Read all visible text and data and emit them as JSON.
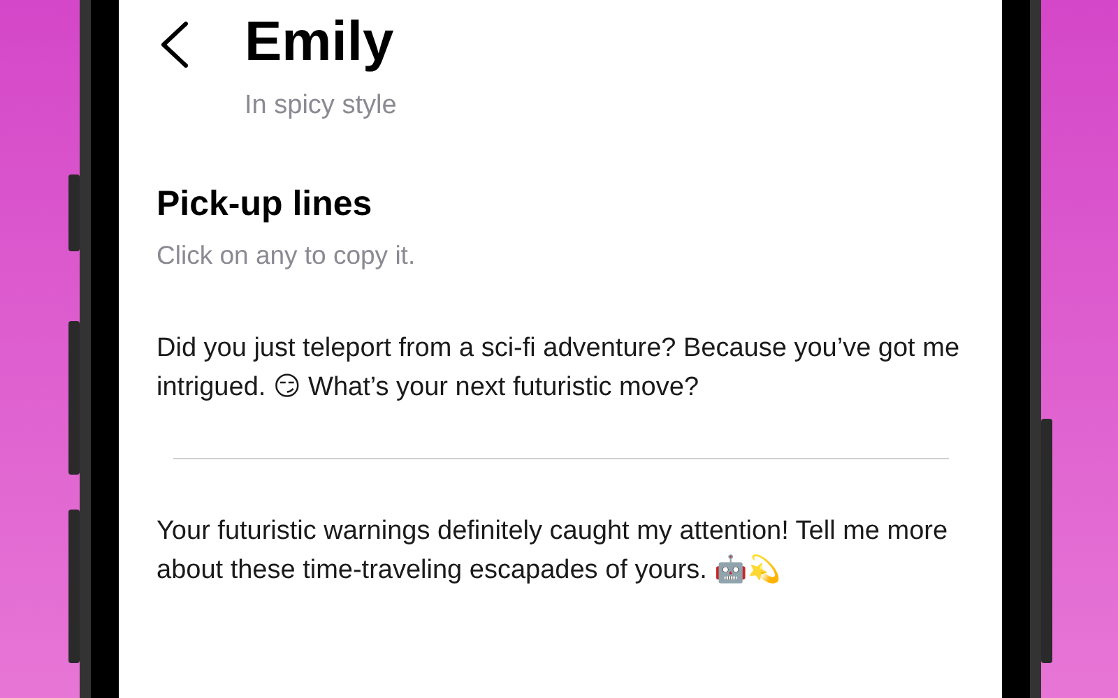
{
  "header": {
    "title": "Emily",
    "subtitle": "In spicy style"
  },
  "section": {
    "title": "Pick-up lines",
    "hint": "Click on any to copy it."
  },
  "lines": [
    {
      "text": "Did you just teleport from a sci-fi adventure? Because you’ve got me intrigued. 😏 What’s your next futuristic move?"
    },
    {
      "text": "Your futuristic warnings definitely caught my attention! Tell me more about these time-traveling escapades of yours. 🤖💫"
    }
  ]
}
